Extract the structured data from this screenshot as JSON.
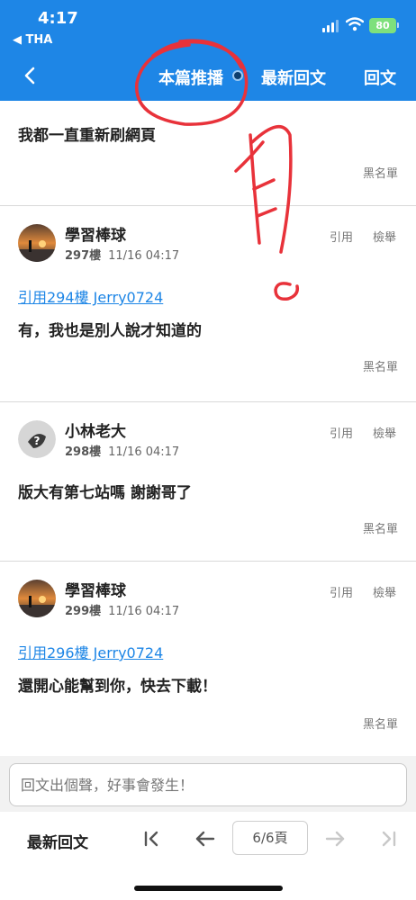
{
  "status_bar": {
    "time": "4:17",
    "back_app": "◀ THA",
    "battery": "80"
  },
  "nav": {
    "title": "本篇推播",
    "latest": "最新回文",
    "reply": "回文"
  },
  "posts": [
    {
      "text": "我都一直重新刷網頁",
      "blacklist": "黑名單"
    },
    {
      "author": "學習棒球",
      "floor": "297樓",
      "datetime": "11/16 04:17",
      "quote_label": "引用",
      "report_label": "檢舉",
      "quote_link": "引用294樓 Jerry0724",
      "text": "有，我也是別人說才知道的",
      "blacklist": "黑名單"
    },
    {
      "author": "小林老大",
      "floor": "298樓",
      "datetime": "11/16 04:17",
      "quote_label": "引用",
      "report_label": "檢舉",
      "text": "版大有第七站嗎 謝謝哥了",
      "blacklist": "黑名單"
    },
    {
      "author": "學習棒球",
      "floor": "299樓",
      "datetime": "11/16 04:17",
      "quote_label": "引用",
      "report_label": "檢舉",
      "quote_link": "引用296樓 Jerry0724",
      "text": "還開心能幫到你，快去下載！",
      "blacklist": "黑名單"
    }
  ],
  "reply": {
    "placeholder": "回文出個聲，好事會發生！"
  },
  "pager": {
    "latest": "最新回文",
    "page": "6/6頁"
  },
  "colors": {
    "accent": "#1e86e6",
    "annotation": "#e8323a"
  }
}
